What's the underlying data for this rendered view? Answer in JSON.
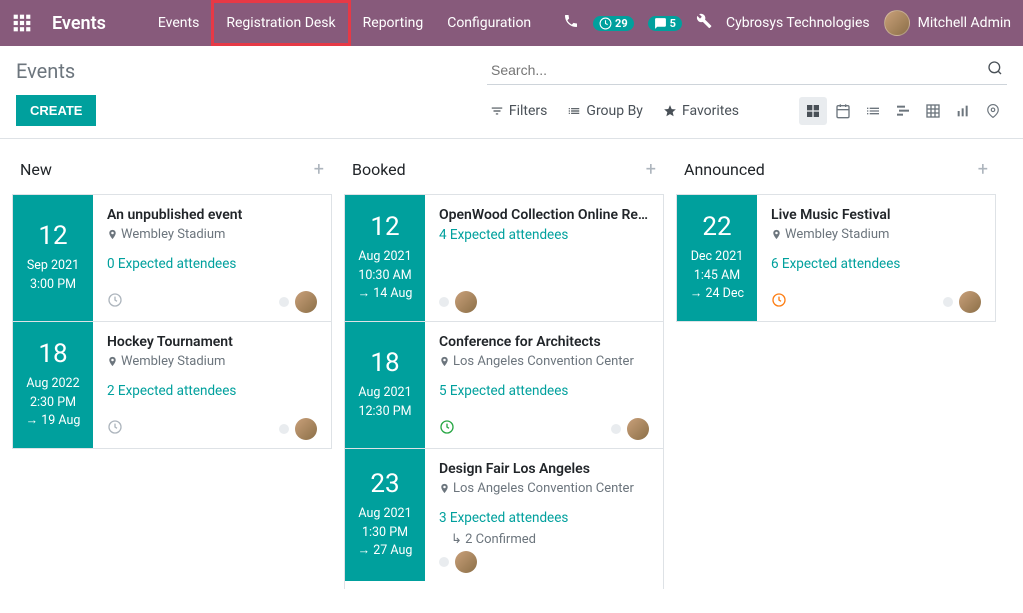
{
  "topbar": {
    "brand": "Events",
    "nav": [
      {
        "label": "Events",
        "highlighted": false
      },
      {
        "label": "Registration Desk",
        "highlighted": true
      },
      {
        "label": "Reporting",
        "highlighted": false
      },
      {
        "label": "Configuration",
        "highlighted": false
      }
    ],
    "clock_badge": "29",
    "chat_badge": "5",
    "company": "Cybrosys Technologies",
    "user": "Mitchell Admin"
  },
  "page_title": "Events",
  "search_placeholder": "Search...",
  "create_label": "CREATE",
  "filters": {
    "filters": "Filters",
    "groupby": "Group By",
    "favorites": "Favorites"
  },
  "columns": [
    {
      "title": "New",
      "cards": [
        {
          "day": "12",
          "lines": [
            "Sep 2021",
            "3:00 PM"
          ],
          "title": "An unpublished event",
          "location": "Wembley Stadium",
          "attendees": "0 Expected attendees",
          "clock": "grey",
          "confirmed": null
        },
        {
          "day": "18",
          "lines": [
            "Aug 2022",
            "2:30 PM",
            "→ 19 Aug"
          ],
          "title": "Hockey Tournament",
          "location": "Wembley Stadium",
          "attendees": "2 Expected attendees",
          "clock": "grey",
          "confirmed": null
        }
      ]
    },
    {
      "title": "Booked",
      "cards": [
        {
          "day": "12",
          "lines": [
            "Aug 2021",
            "10:30 AM",
            "→ 14 Aug"
          ],
          "title": "OpenWood Collection Online Re…",
          "location": null,
          "attendees": "4 Expected attendees",
          "clock": "none",
          "confirmed": null
        },
        {
          "day": "18",
          "lines": [
            "Aug 2021",
            "12:30 PM"
          ],
          "title": "Conference for Architects",
          "location": "Los Angeles Convention Center",
          "attendees": "5 Expected attendees",
          "clock": "green",
          "confirmed": null
        },
        {
          "day": "23",
          "lines": [
            "Aug 2021",
            "1:30 PM",
            "→ 27 Aug"
          ],
          "title": "Design Fair Los Angeles",
          "location": "Los Angeles Convention Center",
          "attendees": "3 Expected attendees",
          "clock": "none",
          "confirmed": "↳ 2 Confirmed"
        }
      ]
    },
    {
      "title": "Announced",
      "cards": [
        {
          "day": "22",
          "lines": [
            "Dec 2021",
            "1:45 AM",
            "→ 24 Dec"
          ],
          "title": "Live Music Festival",
          "location": "Wembley Stadium",
          "attendees": "6 Expected attendees",
          "clock": "orange",
          "confirmed": null
        }
      ]
    }
  ]
}
